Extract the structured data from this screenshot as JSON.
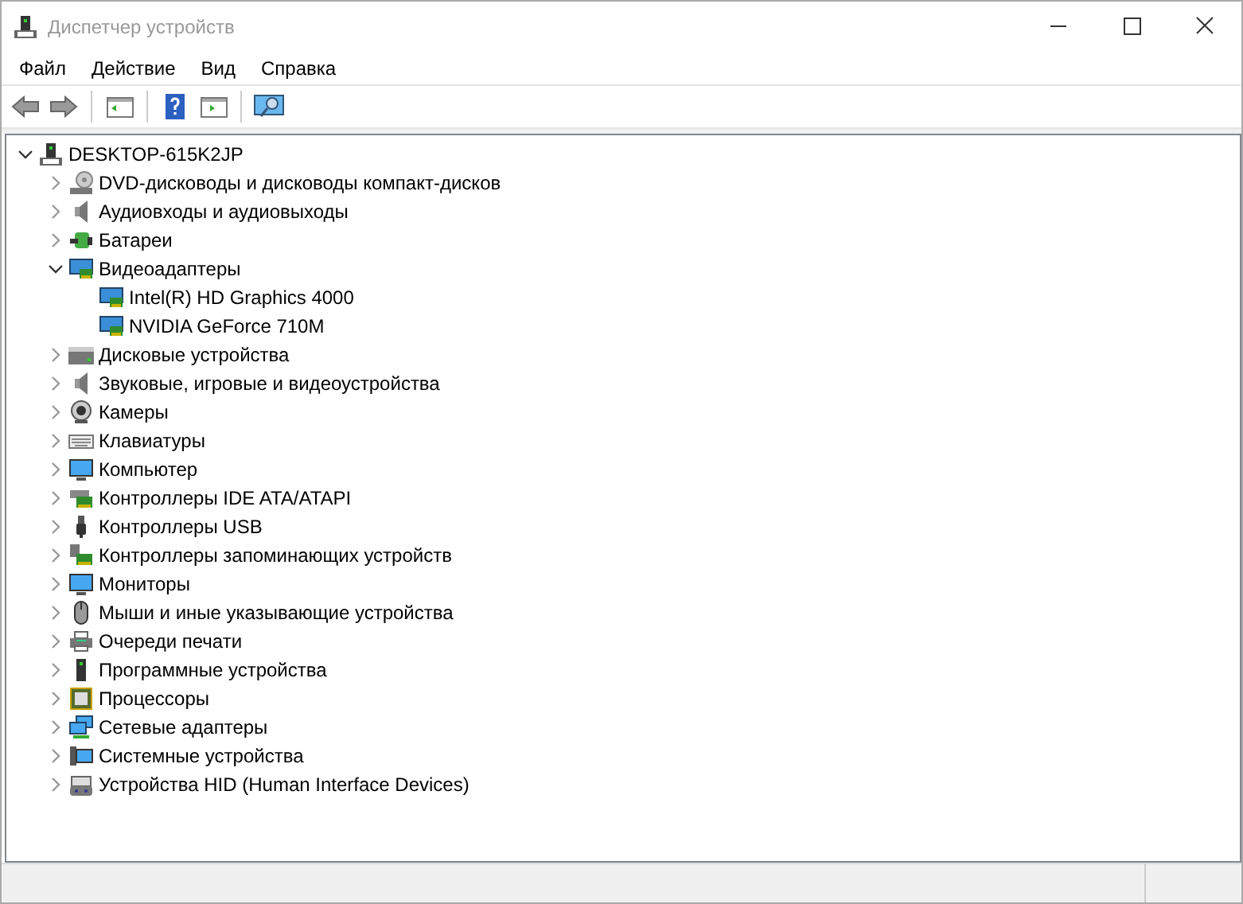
{
  "window": {
    "title": "Диспетчер устройств"
  },
  "menu": [
    "Файл",
    "Действие",
    "Вид",
    "Справка"
  ],
  "tree": {
    "label": "DESKTOP-615K2JP",
    "kind": "computer_root",
    "expanded": true,
    "children": [
      {
        "label": "DVD-дисководы и дисководы компакт-дисков",
        "kind": "dvd",
        "expanded": false
      },
      {
        "label": "Аудиовходы и аудиовыходы",
        "kind": "audio",
        "expanded": false
      },
      {
        "label": "Батареи",
        "kind": "battery",
        "expanded": false
      },
      {
        "label": "Видеоадаптеры",
        "kind": "display",
        "expanded": true,
        "children": [
          {
            "label": "Intel(R) HD Graphics 4000",
            "kind": "display"
          },
          {
            "label": "NVIDIA GeForce 710M",
            "kind": "display"
          }
        ]
      },
      {
        "label": "Дисковые устройства",
        "kind": "disk",
        "expanded": false
      },
      {
        "label": "Звуковые, игровые и видеоустройства",
        "kind": "audio",
        "expanded": false
      },
      {
        "label": "Камеры",
        "kind": "camera",
        "expanded": false
      },
      {
        "label": "Клавиатуры",
        "kind": "keyboard",
        "expanded": false
      },
      {
        "label": "Компьютер",
        "kind": "monitor",
        "expanded": false
      },
      {
        "label": "Контроллеры IDE ATA/ATAPI",
        "kind": "ide",
        "expanded": false
      },
      {
        "label": "Контроллеры USB",
        "kind": "usb",
        "expanded": false
      },
      {
        "label": "Контроллеры запоминающих устройств",
        "kind": "storage",
        "expanded": false
      },
      {
        "label": "Мониторы",
        "kind": "monitor",
        "expanded": false
      },
      {
        "label": "Мыши и иные указывающие устройства",
        "kind": "mouse",
        "expanded": false
      },
      {
        "label": "Очереди печати",
        "kind": "printer",
        "expanded": false
      },
      {
        "label": "Программные устройства",
        "kind": "firmware",
        "expanded": false
      },
      {
        "label": "Процессоры",
        "kind": "cpu",
        "expanded": false
      },
      {
        "label": "Сетевые адаптеры",
        "kind": "network",
        "expanded": false
      },
      {
        "label": "Системные устройства",
        "kind": "system",
        "expanded": false
      },
      {
        "label": "Устройства HID (Human Interface Devices)",
        "kind": "hid",
        "expanded": false
      }
    ]
  }
}
